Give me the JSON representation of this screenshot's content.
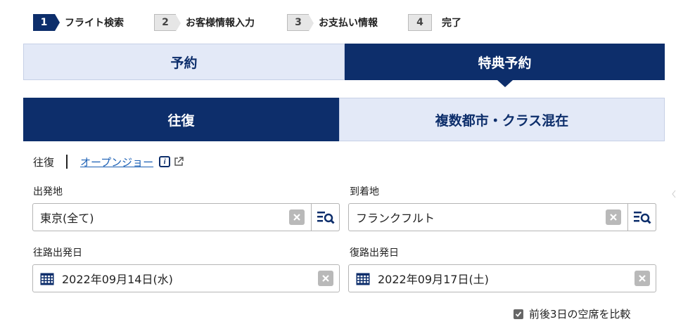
{
  "steps": [
    {
      "num": "1",
      "label": "フライト検索"
    },
    {
      "num": "2",
      "label": "お客様情報入力"
    },
    {
      "num": "3",
      "label": "お支払い情報"
    },
    {
      "num": "4",
      "label": "完了"
    }
  ],
  "main_tabs": {
    "reservation": "予約",
    "award": "特典予約"
  },
  "trip_tabs": {
    "round_trip": "往復",
    "multi_city": "複数都市・クラス混在"
  },
  "subrow": {
    "current": "往復",
    "open_jaw": "オープンジョー",
    "info": "i"
  },
  "fields": {
    "origin": {
      "label": "出発地",
      "value": "東京(全て)"
    },
    "destination": {
      "label": "到着地",
      "value": "フランクフルト"
    },
    "outbound_date": {
      "label": "往路出発日",
      "value": "2022年09月14日(水)"
    },
    "return_date": {
      "label": "復路出発日",
      "value": "2022年09月17日(土)"
    }
  },
  "compare": {
    "label": "前後3日の空席を比較",
    "checked": true
  },
  "colors": {
    "navy": "#0d2e6b",
    "light_tab": "#e3e9f7",
    "link": "#1a5fb4"
  },
  "icons": {
    "clear": "clear-x-icon",
    "search": "list-search-icon",
    "calendar": "calendar-icon",
    "external": "external-link-icon"
  }
}
